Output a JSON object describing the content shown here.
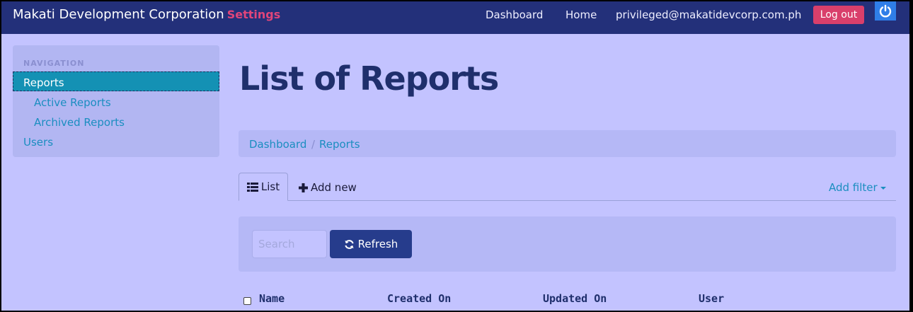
{
  "navbar": {
    "brand": "Makati Development Corporation",
    "brand_accent": "Settings",
    "links": [
      "Dashboard",
      "Home",
      "privileged@makatidevcorp.com.ph"
    ],
    "logout_label": "Log out"
  },
  "sidebar": {
    "heading": "NAVIGATION",
    "items": [
      {
        "label": "Reports"
      },
      {
        "label": "Active Reports"
      },
      {
        "label": "Archived Reports"
      },
      {
        "label": "Users"
      }
    ]
  },
  "main": {
    "title": "List of Reports",
    "breadcrumb": [
      "Dashboard",
      "Reports"
    ],
    "breadcrumb_sep": "/",
    "tabs": [
      {
        "label": "List",
        "icon": "list-icon"
      },
      {
        "label": "Add new",
        "icon": "plus-icon"
      }
    ],
    "add_filter_label": "Add filter",
    "search_placeholder": "Search",
    "refresh_label": "Refresh",
    "table_headers": [
      "Name",
      "Created On",
      "Updated On",
      "User"
    ]
  },
  "colors": {
    "navbar": "#23307a",
    "accent": "#e0457a",
    "logout": "#d93f6b",
    "link": "#1b8ec0",
    "page_bg": "#c3c3ff",
    "button": "#263c8c"
  }
}
